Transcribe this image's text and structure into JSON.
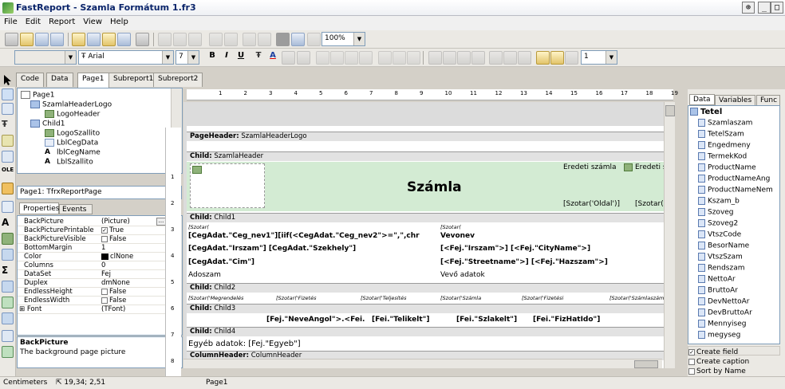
{
  "app": {
    "title": "FastReport - Szamla Formátum 1.fr3"
  },
  "menu": [
    "File",
    "Edit",
    "Report",
    "View",
    "Help"
  ],
  "toolbar": {
    "zoom": "100%",
    "font_name": "Arial",
    "font_size": "7",
    "line_width": "1"
  },
  "tabs": [
    "Code",
    "Data",
    "Page1",
    "Subreport1",
    "Subreport2"
  ],
  "active_tab": "Page1",
  "report_tree": [
    {
      "label": "Page1",
      "level": 0,
      "type": "page"
    },
    {
      "label": "SzamlaHeaderLogo",
      "level": 1,
      "type": "band"
    },
    {
      "label": "LogoHeader",
      "level": 2,
      "type": "picture"
    },
    {
      "label": "Child1",
      "level": 1,
      "type": "band"
    },
    {
      "label": "LogoSzallito",
      "level": 2,
      "type": "picture"
    },
    {
      "label": "LblCegData",
      "level": 2,
      "type": "memo"
    },
    {
      "label": "lblCegName",
      "level": 2,
      "type": "text"
    },
    {
      "label": "LblSzallito",
      "level": 2,
      "type": "text"
    }
  ],
  "object_combo": "Page1: TfrxReportPage",
  "inspector_tabs": [
    "Properties",
    "Events"
  ],
  "properties": [
    {
      "name": "BackPicture",
      "value": "(Picture)",
      "type": "pic"
    },
    {
      "name": "BackPicturePrintable",
      "value": "True",
      "type": "check_on"
    },
    {
      "name": "BackPictureVisible",
      "value": "False",
      "type": "check_off"
    },
    {
      "name": "BottomMargin",
      "value": "1",
      "type": "text"
    },
    {
      "name": "Color",
      "value": "clNone",
      "type": "color"
    },
    {
      "name": "Columns",
      "value": "0",
      "type": "text"
    },
    {
      "name": "DataSet",
      "value": "Fej",
      "type": "text"
    },
    {
      "name": "Duplex",
      "value": "dmNone",
      "type": "text"
    },
    {
      "name": "EndlessHeight",
      "value": "False",
      "type": "check_off"
    },
    {
      "name": "EndlessWidth",
      "value": "False",
      "type": "check_off"
    },
    {
      "name": "Font",
      "value": "(TFont)",
      "type": "expand"
    }
  ],
  "prop_description": {
    "title": "BackPicture",
    "text": "The background page picture"
  },
  "ruler_numbers": [
    "1",
    "2",
    "3",
    "4",
    "5",
    "6",
    "7",
    "8",
    "9",
    "10",
    "11",
    "12",
    "13",
    "14",
    "15",
    "16",
    "17",
    "18",
    "19"
  ],
  "vruler_numbers": [
    "1",
    "2",
    "3",
    "4",
    "5",
    "6",
    "7",
    "8"
  ],
  "bands": {
    "pageheader": {
      "kind": "PageHeader:",
      "name": "SzamlaHeaderLogo"
    },
    "child_header": {
      "kind": "Child:",
      "name": "SzamlaHeader"
    },
    "child1": {
      "kind": "Child:",
      "name": "Child1"
    },
    "child2": {
      "kind": "Child:",
      "name": "Child2"
    },
    "child3": {
      "kind": "Child:",
      "name": "Child3"
    },
    "child4": {
      "kind": "Child:",
      "name": "Child4"
    },
    "columnheader": {
      "kind": "ColumnHeader:",
      "name": "ColumnHeader"
    }
  },
  "canvas": {
    "eredeti1": "Eredeti számla",
    "eredeti2": "Eredeti szá",
    "szamla": "Számla",
    "szotar_oldal1": "[Szotar('Oldal')]",
    "szotar_oldal2": "[Szotar('Old",
    "szotar_small": "[Szotar(",
    "ceg_name": "[CegAdat.\"Ceg_nev1\"][iif(<CegAdat.\"Ceg_nev2\">=\",\",chr",
    "ceg_irsz": "[CegAdat.\"Irszam\"] [CegAdat.\"Szekhely\"]",
    "ceg_cim": "[CegAdat.\"Cim\"]",
    "adoszam": "Adoszam",
    "vevonev": "Vevonev",
    "fej_irsz": "[<Fej.\"Irszam\">] [<Fej.\"CityName\">]",
    "fej_street": "[<Fej.\"Streetname\">] [<Fej.\"Hazszam\">]",
    "vevo_adatok": "Vevő adatok",
    "child2_labels": [
      "[Szotar('Megrendelés",
      "[Szotar('Fizetés",
      "[Szotar('Teljesítés",
      "[Szotar('Számla",
      "[Szotar('Fizetési",
      "[Szotar('Számlaszáma','"
    ],
    "child3_fields": [
      "[Fej.\"NeveAngol\">.<Fei.",
      "[Fei.\"Telikelt\"]",
      "[Fei.\"Szlakelt\"]",
      "[Fei.\"FizHatIdo\"]"
    ],
    "egyeb": "Egyéb adatok: [Fej.\"Egyeb\"]"
  },
  "data_panel": {
    "tabs": [
      "Data",
      "Variables",
      "Func"
    ],
    "root": "Tetel",
    "fields": [
      "Szamlaszam",
      "TetelSzam",
      "Engedmeny",
      "TermekKod",
      "ProductName",
      "ProductNameAng",
      "ProductNameNem",
      "Kszam_b",
      "Szoveg",
      "Szoveg2",
      "VtszCode",
      "BesorName",
      "VtszSzam",
      "Rendszam",
      "NettoAr",
      "BruttoAr",
      "DevNettoAr",
      "DevBruttoAr",
      "Mennyiseg",
      "megyseg"
    ],
    "options": [
      {
        "label": "Create field",
        "checked": true
      },
      {
        "label": "Create caption",
        "checked": false
      },
      {
        "label": "Sort by Name",
        "checked": false
      }
    ]
  },
  "status": {
    "units": "Centimeters",
    "position": "19,34; 2,51",
    "page": "Page1"
  },
  "colors": {
    "band_fill": "#d3ebd3",
    "band_header": "#e2e2e2",
    "title_text": "#0a246a"
  }
}
